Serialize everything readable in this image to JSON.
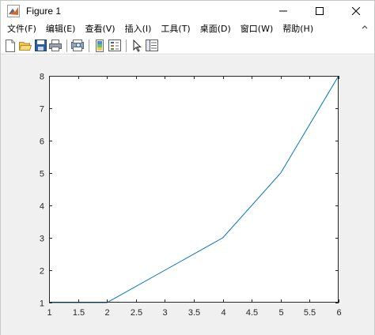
{
  "window": {
    "title": "Figure 1"
  },
  "menu": [
    "文件(F)",
    "编辑(E)",
    "查看(V)",
    "插入(I)",
    "工具(T)",
    "桌面(D)",
    "窗口(W)",
    "帮助(H)"
  ],
  "toolbar": {
    "buttons": [
      "new-figure",
      "open-file",
      "save",
      "print",
      "print-preview",
      "link-plot",
      "insert-legend",
      "edit-plot",
      "property-inspector"
    ]
  },
  "colors": {
    "line": "#0072bd",
    "axes_bg": "#ffffff",
    "figure_bg": "#f0f0f0",
    "axis": "#262626"
  },
  "chart_data": {
    "type": "line",
    "x": [
      1,
      2,
      3,
      4,
      5,
      6
    ],
    "series": [
      {
        "values": [
          1,
          1,
          2,
          3,
          5,
          8
        ]
      }
    ],
    "xlim": [
      1,
      6
    ],
    "ylim": [
      1,
      8
    ],
    "xticks": [
      "1",
      "1.5",
      "2",
      "2.5",
      "3",
      "3.5",
      "4",
      "4.5",
      "5",
      "5.5",
      "6"
    ],
    "yticks": [
      "1",
      "2",
      "3",
      "4",
      "5",
      "6",
      "7",
      "8"
    ],
    "title": "",
    "xlabel": "",
    "ylabel": "",
    "grid": false
  }
}
